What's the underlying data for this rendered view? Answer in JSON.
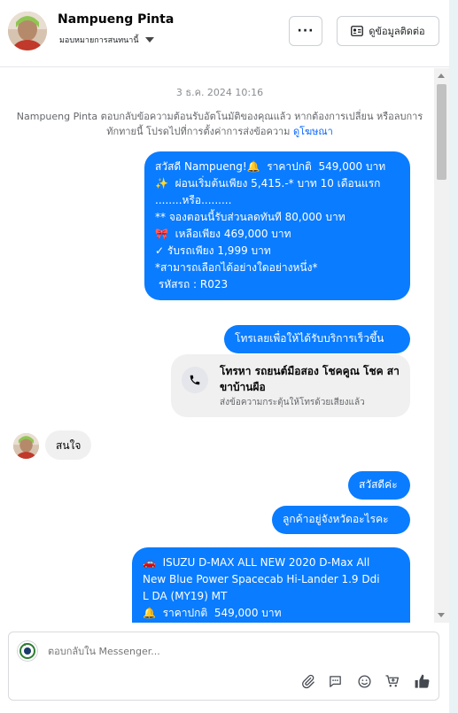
{
  "header": {
    "contact_name": "Nampueng Pinta",
    "assign_label": "มอบหมายการสนทนานี้",
    "more_label": "···",
    "contact_info_label": "ดูข้อมูลติดต่อ"
  },
  "chat": {
    "timestamp": "3 ธ.ค. 2024 10:16",
    "notice_text": "Nampueng Pinta ตอบกลับข้อความต้อนรับอัตโนมัติของคุณแล้ว หากต้องการเปลี่ยน หรือลบการทักทายนี้ โปรดไปที่การตั้งค่าการส่งข้อความ",
    "notice_link": "ดูโฆษณา",
    "messages": [
      {
        "lines": [
          "สวัสดี Nampueng!🔔  ราคาปกติ  549,000 บาท",
          "✨  ผ่อนเริ่มต้นเพียง 5,415.-* บาท 10 เดือนแรก",
          "........หรือ.........",
          "** จองตอนนี้รับส่วนลดทันที 80,000 บาท",
          "🎀  เหลือเพียง 469,000 บาท",
          "✓ รับรถเพียง 1,999 บาท",
          "*สามารถเลือกได้อย่างใดอย่างหนึ่ง*",
          "",
          " รหัสรถ : R023"
        ]
      },
      {
        "text": "โทรเลยเพื่อให้ได้รับบริการเร็วขึ้น"
      },
      {
        "text": "สนใจ"
      },
      {
        "text": "สวัสดีค่ะ"
      },
      {
        "text": "ลูกค้าอยู่จังหวัดอะไรคะ"
      },
      {
        "lines": [
          "🚗  ISUZU D-MAX ALL NEW 2020 D-Max All",
          "New Blue Power Spacecab Hi-Lander 1.9 Ddi",
          "L DA (MY19) MT",
          "🔔  ราคาปกติ  549,000 บาท"
        ]
      }
    ],
    "call_card": {
      "title": "โทรหา รถยนต์มือสอง โชคคูณ โชค สาขาบ้านผือ",
      "subtitle": "ส่งข้อความกระตุ้นให้โทรด้วยเสียงแล้ว"
    }
  },
  "composer": {
    "placeholder": "ตอบกลับใน Messenger..."
  },
  "icons": [
    "phone-icon",
    "attach-icon",
    "saved-reply-icon",
    "emoji-icon",
    "cart-icon",
    "like-icon",
    "contact-card-icon",
    "chevron-down-icon"
  ]
}
